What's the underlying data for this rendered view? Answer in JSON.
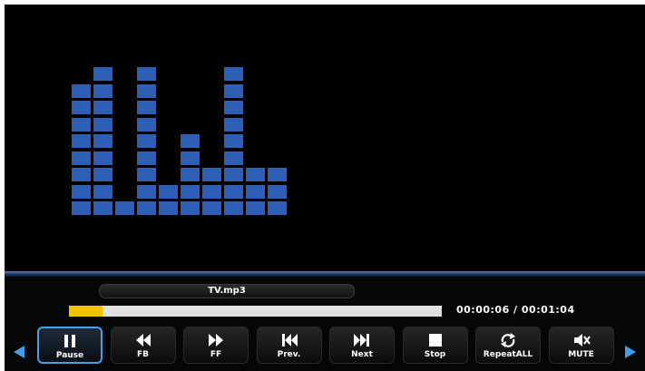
{
  "player": {
    "filename": "TV.mp3",
    "time_display": "00:00:06 / 00:01:04",
    "progress": 0.09
  },
  "equalizer": {
    "column_levels": [
      8,
      9,
      1,
      9,
      2,
      5,
      3,
      9,
      3,
      3
    ],
    "bar_color": "#2d5fb6"
  },
  "controls": [
    {
      "name": "pause",
      "label": "Pause",
      "icon": "pause-icon",
      "selected": true
    },
    {
      "name": "fb",
      "label": "FB",
      "icon": "fast-backward-icon",
      "selected": false
    },
    {
      "name": "ff",
      "label": "FF",
      "icon": "fast-forward-icon",
      "selected": false
    },
    {
      "name": "prev",
      "label": "Prev.",
      "icon": "previous-track-icon",
      "selected": false
    },
    {
      "name": "next",
      "label": "Next",
      "icon": "next-track-icon",
      "selected": false
    },
    {
      "name": "stop",
      "label": "Stop",
      "icon": "stop-icon",
      "selected": false
    },
    {
      "name": "repeat-all",
      "label": "RepeatALL",
      "icon": "repeat-icon",
      "selected": false
    },
    {
      "name": "mute",
      "label": "MUTE",
      "icon": "mute-icon",
      "selected": false
    }
  ],
  "navigation": {
    "left_arrow": "arrow-left-icon",
    "right_arrow": "arrow-right-icon"
  },
  "colors": {
    "accent": "#4aa0e8",
    "progress_fill": "#f2c200",
    "progress_track": "#e0e0e0",
    "background": "#000000"
  }
}
